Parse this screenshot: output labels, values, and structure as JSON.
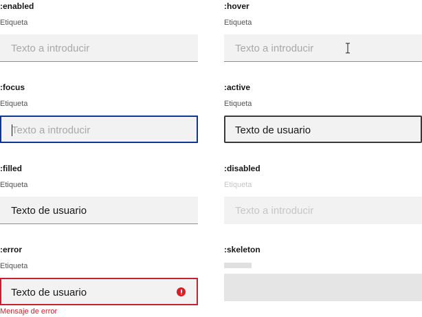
{
  "states": {
    "enabled": {
      "title": ":enabled",
      "label": "Etiqueta",
      "placeholder": "Texto a introducir"
    },
    "hover": {
      "title": ":hover",
      "label": "Etiqueta",
      "placeholder": "Texto a introducir",
      "cursor_icon": "text-cursor-icon"
    },
    "focus": {
      "title": ":focus",
      "label": "Etiqueta",
      "placeholder": "Texto a introducir"
    },
    "active": {
      "title": ":active",
      "label": "Etiqueta",
      "value": "Texto de usuario"
    },
    "filled": {
      "title": ":filled",
      "label": "Etiqueta",
      "value": "Texto de usuario"
    },
    "disabled": {
      "title": ":disabled",
      "label": "Etiqueta",
      "placeholder": "Texto a introducir"
    },
    "error": {
      "title": ":error",
      "label": "Etiqueta",
      "value": "Texto de usuario",
      "message": "Mensaje de error",
      "icon": "error-icon"
    },
    "skeleton": {
      "title": ":skeleton"
    }
  },
  "colors": {
    "focus_border": "#0f3592",
    "error": "#da1e28",
    "field_background": "#f2f2f2",
    "skeleton": "#e5e5e5"
  }
}
